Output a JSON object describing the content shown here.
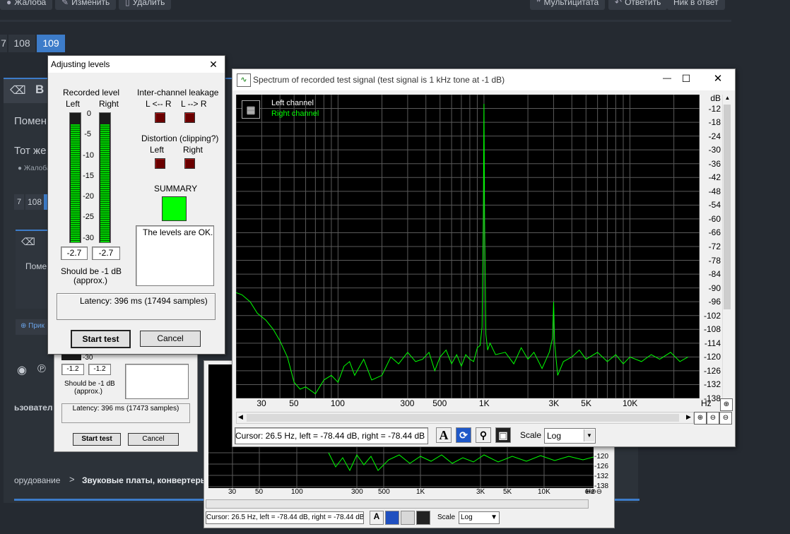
{
  "forum": {
    "top_buttons": [
      "Жалоба",
      "Изменить",
      "Удалить",
      "Мультицитата",
      "Ответить",
      "Ник в ответ"
    ],
    "pages": [
      "108",
      "109"
    ],
    "page_prefix": "7",
    "line1": "Помен",
    "line2": "Тот же",
    "complaint": "Жалоба",
    "pages2": [
      "7",
      "108"
    ],
    "bold_h": "В",
    "mini_text": "Поме",
    "pin_link": "Прик",
    "user_text": "ьзовател",
    "breadcrumb_prev": "орудование",
    "breadcrumb_sep": ">",
    "breadcrumb_cur": "Звуковые платы, конвертеры"
  },
  "adjust": {
    "title": "Adjusting levels",
    "recorded_level": "Recorded level",
    "left": "Left",
    "right": "Right",
    "scale": [
      "0",
      "-5",
      "-10",
      "-15",
      "-20",
      "-25",
      "-30"
    ],
    "left_value": "-2.7",
    "right_value": "-2.7",
    "should_be": "Should be  -1 dB",
    "approx": "(approx.)",
    "leakage_title": "Inter-channel leakage",
    "leak_lr": "L <-- R",
    "leak_rl": "L --> R",
    "distortion_title": "Distortion (clipping?)",
    "dist_left": "Left",
    "dist_right": "Right",
    "summary": "SUMMARY",
    "status_text": "The levels are OK.",
    "latency": "Latency: 396 ms (17494 samples)",
    "start_btn": "Start test",
    "cancel_btn": "Cancel",
    "close_glyph": "✕",
    "colors": {
      "meter": "#00d200",
      "led": "#6a0000",
      "summary": "#00ff00"
    },
    "meter_level": {
      "left_db": -2.7,
      "right_db": -2.7
    }
  },
  "adjust_bg": {
    "scale_bottom": "-30",
    "left_value": "-1.2",
    "right_value": "-1.2",
    "should_be": "Should be  -1 dB",
    "approx": "(approx.)",
    "latency": "Latency: 396 ms (17473 samples)",
    "start_btn": "Start test",
    "cancel_btn": "Cancel"
  },
  "spectrum": {
    "title": "Spectrum of recorded test signal (test signal is 1 kHz tone at -1 dB)",
    "minimize": "—",
    "maximize": "☐",
    "close": "✕",
    "legend_left": "Left channel",
    "legend_right": "Right channel",
    "db_unit": "dB",
    "hz_unit": "Hz",
    "cursor": "Cursor:  26.5 Hz,  left = -78.44 dB,  right = -78.44 dB",
    "scale_label": "Scale",
    "scale_value": "Log",
    "tool_a": "A",
    "colors": {
      "background": "#000000",
      "grid": "#5a5a5a",
      "left": "#ffffff",
      "right": "#00ff00"
    },
    "chart_data": {
      "type": "line",
      "xscale": "log",
      "xlabel": "Hz",
      "ylabel": "dB",
      "xlim": [
        20,
        30000
      ],
      "ylim": [
        -138,
        -6
      ],
      "x_ticks": [
        "30",
        "50",
        "100",
        "300",
        "500",
        "1K",
        "3K",
        "5K",
        "10K"
      ],
      "x_tick_values": [
        30,
        50,
        100,
        300,
        500,
        1000,
        3000,
        5000,
        10000
      ],
      "y_ticks": [
        "-12",
        "-18",
        "-24",
        "-30",
        "-36",
        "-42",
        "-48",
        "-54",
        "-60",
        "-66",
        "-72",
        "-78",
        "-84",
        "-90",
        "-96",
        "-102",
        "-108",
        "-114",
        "-120",
        "-126",
        "-132",
        "-138"
      ],
      "grid": true,
      "legend": "top-left",
      "series": [
        {
          "name": "Right channel",
          "x": [
            20,
            22,
            25,
            28,
            32,
            36,
            40,
            45,
            50,
            55,
            60,
            70,
            80,
            90,
            100,
            110,
            120,
            130,
            150,
            170,
            200,
            230,
            260,
            300,
            340,
            380,
            420,
            460,
            500,
            550,
            600,
            650,
            700,
            750,
            800,
            850,
            900,
            940,
            970,
            990,
            1000,
            1010,
            1030,
            1060,
            1100,
            1200,
            1400,
            1600,
            1800,
            2000,
            2200,
            2500,
            2800,
            2950,
            3000,
            3050,
            3200,
            3500,
            4000,
            4500,
            5000,
            6000,
            7000,
            8000,
            9000,
            10000,
            12000,
            14000,
            16000,
            19000,
            22000,
            25000
          ],
          "y": [
            -92,
            -93,
            -96,
            -101,
            -104,
            -108,
            -113,
            -120,
            -131,
            -134,
            -133,
            -136,
            -130,
            -128,
            -131,
            -124,
            -122,
            -128,
            -121,
            -130,
            -128,
            -120,
            -123,
            -118,
            -122,
            -121,
            -118,
            -126,
            -120,
            -117,
            -123,
            -119,
            -124,
            -119,
            -121,
            -122,
            -116,
            -115,
            -107,
            -60,
            -10,
            -62,
            -110,
            -117,
            -114,
            -119,
            -118,
            -123,
            -116,
            -121,
            -118,
            -125,
            -118,
            -112,
            -96,
            -114,
            -128,
            -122,
            -120,
            -117,
            -121,
            -118,
            -122,
            -119,
            -123,
            -120,
            -122,
            -119,
            -121,
            -118,
            -122,
            -120
          ]
        }
      ]
    }
  },
  "spectrum_bg": {
    "x_ticks": [
      "30",
      "50",
      "100",
      "300",
      "500",
      "1K",
      "3K",
      "5K",
      "10K"
    ],
    "y_ticks": [
      "-120",
      "-126",
      "-132",
      "-138"
    ],
    "hz_unit": "Hz",
    "cursor": "Cursor:  26.5 Hz,  left = -78.44 dB,  right = -78.44 dB",
    "scale_label": "Scale",
    "scale_value": "Log",
    "tool_a": "A"
  }
}
